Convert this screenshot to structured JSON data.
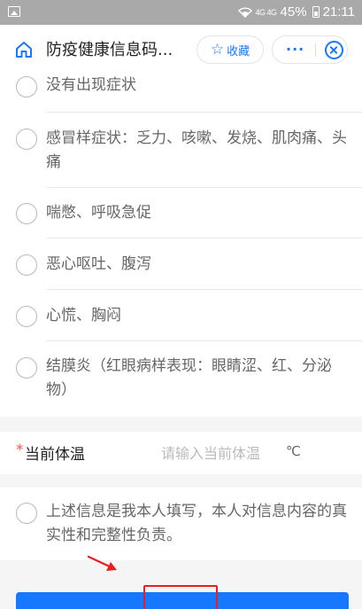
{
  "status_bar": {
    "network": "4G 4G",
    "battery": "45%",
    "time": "21:11"
  },
  "nav": {
    "title": "防疫健康信息码...",
    "favorite_label": "收藏",
    "more_label": "···"
  },
  "symptom_options": [
    {
      "label": "没有出现症状"
    },
    {
      "label": "感冒样症状：乏力、咳嗽、发烧、肌肉痛、头痛"
    },
    {
      "label": "喘憋、呼吸急促"
    },
    {
      "label": "恶心呕吐、腹泻"
    },
    {
      "label": "心慌、胸闷"
    },
    {
      "label": "结膜炎（红眼病样表现：眼睛涩、红、分泌物）"
    }
  ],
  "temperature": {
    "required_mark": "*",
    "label": "当前体温",
    "placeholder": "请输入当前体温",
    "value": "",
    "unit": "℃"
  },
  "declaration": {
    "label": "上述信息是我本人填写，本人对信息内容的真实性和完整性负责。"
  },
  "colors": {
    "accent": "#1677ff",
    "required": "#ff4d4f",
    "annotation": "#e8201d",
    "status_bar": "#a9a9a9"
  }
}
